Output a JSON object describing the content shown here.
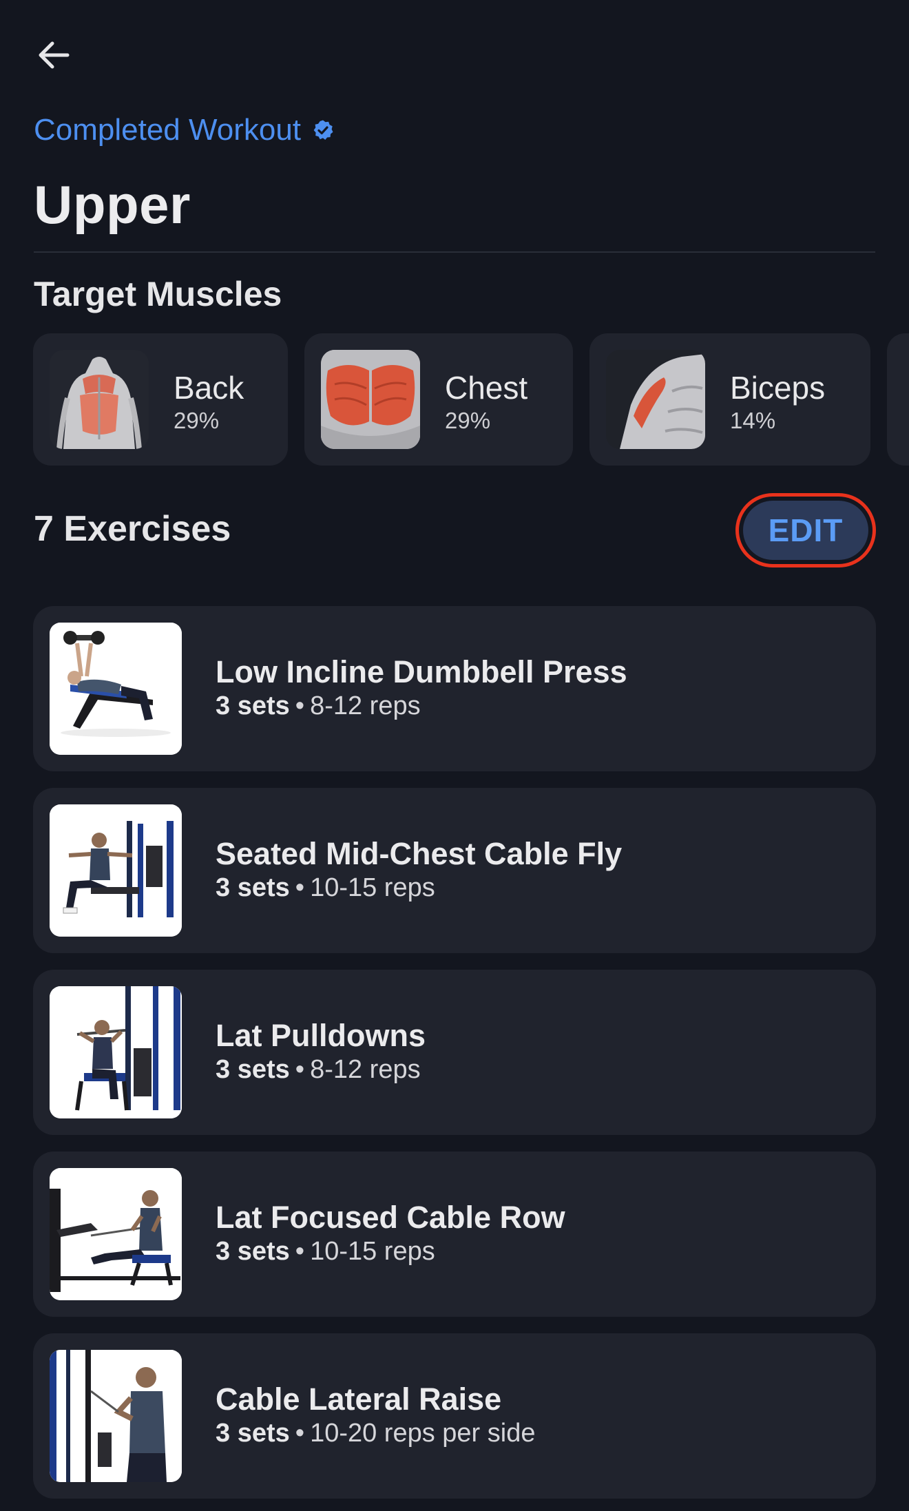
{
  "header": {
    "back_icon": "arrow-left-icon",
    "status_label": "Completed Workout",
    "status_icon": "verified-check-icon",
    "title": "Upper"
  },
  "colors": {
    "background": "#13161f",
    "card": "#20232d",
    "accent_blue": "#4d8ff0",
    "edit_button_bg": "#2c3a59",
    "highlight_ring": "#e8321c"
  },
  "target_muscles": {
    "heading": "Target Muscles",
    "items": [
      {
        "name": "Back",
        "percent": "29%",
        "icon": "back-muscle-icon"
      },
      {
        "name": "Chest",
        "percent": "29%",
        "icon": "chest-muscle-icon"
      },
      {
        "name": "Biceps",
        "percent": "14%",
        "icon": "biceps-muscle-icon"
      }
    ]
  },
  "exercises": {
    "count_label": "7 Exercises",
    "edit_label": "EDIT",
    "items": [
      {
        "name": "Low Incline Dumbbell Press",
        "sets": "3 sets",
        "reps": "8-12 reps"
      },
      {
        "name": "Seated Mid-Chest Cable Fly",
        "sets": "3 sets",
        "reps": "10-15 reps"
      },
      {
        "name": "Lat Pulldowns",
        "sets": "3 sets",
        "reps": "8-12 reps"
      },
      {
        "name": "Lat Focused Cable Row",
        "sets": "3 sets",
        "reps": "10-15 reps"
      },
      {
        "name": "Cable Lateral Raise",
        "sets": "3 sets",
        "reps": "10-20 reps per side"
      }
    ]
  }
}
